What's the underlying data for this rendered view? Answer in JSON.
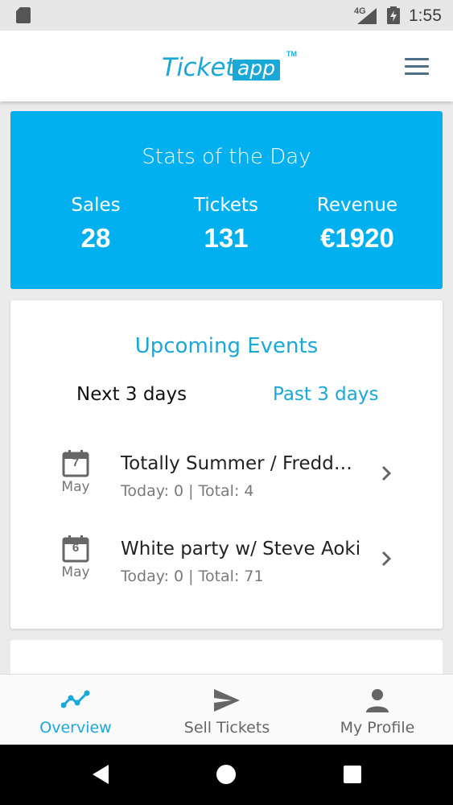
{
  "status_bar": {
    "network": "4G",
    "time": "1:55"
  },
  "header": {
    "logo_ticket": "Ticket",
    "logo_app": "app",
    "logo_tm": "TM"
  },
  "stats": {
    "title": "Stats of the Day",
    "items": [
      {
        "label": "Sales",
        "value": "28"
      },
      {
        "label": "Tickets",
        "value": "131"
      },
      {
        "label": "Revenue",
        "value": "€1920"
      }
    ]
  },
  "events": {
    "title": "Upcoming Events",
    "tabs": [
      {
        "label": "Next 3 days",
        "active": true
      },
      {
        "label": "Past 3 days",
        "active": false
      }
    ],
    "list": [
      {
        "day": "7",
        "month": "May",
        "name": "Totally Summer / Freddy Le Crack & Friends",
        "stats": "Today: 0 | Total: 4"
      },
      {
        "day": "6",
        "month": "May",
        "name": "White party w/ Steve Aoki",
        "stats": "Today: 0 | Total: 71"
      }
    ]
  },
  "bottom_nav": [
    {
      "label": "Overview",
      "icon": "trend-line-icon",
      "active": true
    },
    {
      "label": "Sell Tickets",
      "icon": "send-icon",
      "active": false
    },
    {
      "label": "My Profile",
      "icon": "person-icon",
      "active": false
    }
  ],
  "colors": {
    "accent": "#03b0ef",
    "brand": "#1aa8d8",
    "text_dark": "#222222",
    "text_muted": "#7a7a7a"
  }
}
